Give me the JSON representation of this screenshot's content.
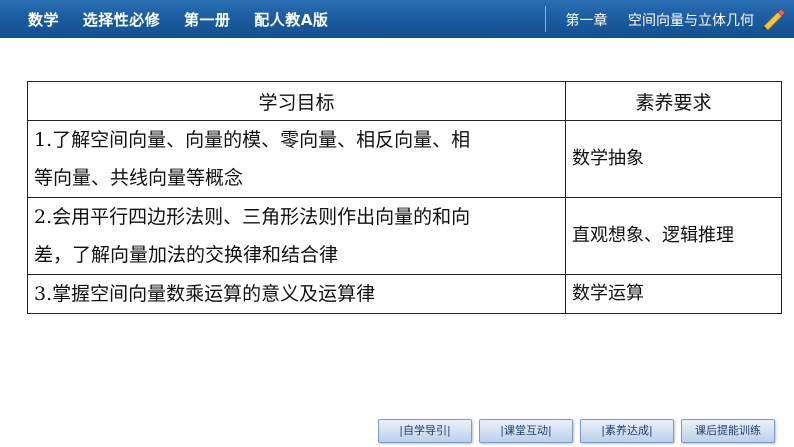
{
  "header": {
    "left_items": [
      "数学",
      "选择性必修",
      "第一册",
      "配人教A版"
    ],
    "right_items": [
      "第一章",
      "空间向量与立体几何"
    ]
  },
  "table": {
    "headers": [
      "学习目标",
      "素养要求"
    ],
    "rows": [
      {
        "goal_lines": [
          "1.了解空间向量、向量的模、零向量、相反向量、相",
          "等向量、共线向量等概念"
        ],
        "literacy": "数学抽象"
      },
      {
        "goal_lines": [
          "2.会用平行四边形法则、三角形法则作出向量的和向",
          "差，了解向量加法的交换律和结合律"
        ],
        "literacy": "直观想象、逻辑推理"
      },
      {
        "goal_lines": [
          "3.掌握空间向量数乘运算的意义及运算律"
        ],
        "literacy": "数学运算"
      }
    ]
  },
  "nav": [
    "|自学导引|",
    "|课堂互动|",
    "|素养达成|",
    "课后提能训练"
  ]
}
